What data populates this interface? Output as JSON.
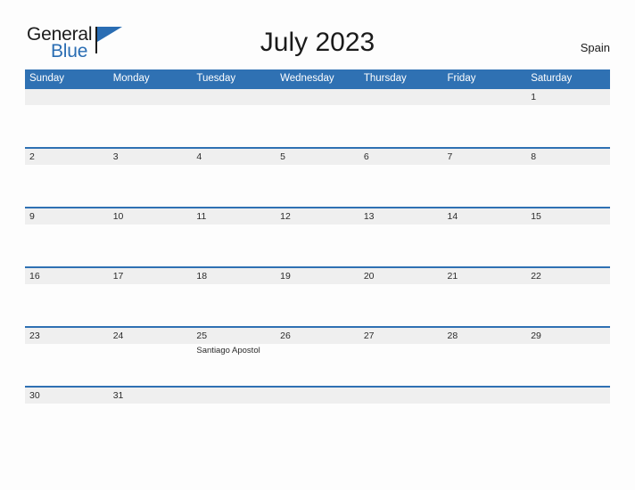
{
  "brand": {
    "name_part1": "General",
    "name_part2": "Blue",
    "flag_icon": "triangle-flag-icon",
    "color_dark": "#1b1b1b",
    "color_blue": "#2a6db3"
  },
  "header": {
    "title": "July 2023",
    "country": "Spain"
  },
  "theme": {
    "header_blue": "#2f71b3",
    "day_band_gray": "#efefef",
    "page_background": "#fdfdfd",
    "text_dark": "#1b1b1b"
  },
  "calendar": {
    "weekdays": [
      "Sunday",
      "Monday",
      "Tuesday",
      "Wednesday",
      "Thursday",
      "Friday",
      "Saturday"
    ],
    "weeks": [
      [
        {
          "day": "",
          "event": ""
        },
        {
          "day": "",
          "event": ""
        },
        {
          "day": "",
          "event": ""
        },
        {
          "day": "",
          "event": ""
        },
        {
          "day": "",
          "event": ""
        },
        {
          "day": "",
          "event": ""
        },
        {
          "day": "1",
          "event": ""
        }
      ],
      [
        {
          "day": "2",
          "event": ""
        },
        {
          "day": "3",
          "event": ""
        },
        {
          "day": "4",
          "event": ""
        },
        {
          "day": "5",
          "event": ""
        },
        {
          "day": "6",
          "event": ""
        },
        {
          "day": "7",
          "event": ""
        },
        {
          "day": "8",
          "event": ""
        }
      ],
      [
        {
          "day": "9",
          "event": ""
        },
        {
          "day": "10",
          "event": ""
        },
        {
          "day": "11",
          "event": ""
        },
        {
          "day": "12",
          "event": ""
        },
        {
          "day": "13",
          "event": ""
        },
        {
          "day": "14",
          "event": ""
        },
        {
          "day": "15",
          "event": ""
        }
      ],
      [
        {
          "day": "16",
          "event": ""
        },
        {
          "day": "17",
          "event": ""
        },
        {
          "day": "18",
          "event": ""
        },
        {
          "day": "19",
          "event": ""
        },
        {
          "day": "20",
          "event": ""
        },
        {
          "day": "21",
          "event": ""
        },
        {
          "day": "22",
          "event": ""
        }
      ],
      [
        {
          "day": "23",
          "event": ""
        },
        {
          "day": "24",
          "event": ""
        },
        {
          "day": "25",
          "event": "Santiago Apostol"
        },
        {
          "day": "26",
          "event": ""
        },
        {
          "day": "27",
          "event": ""
        },
        {
          "day": "28",
          "event": ""
        },
        {
          "day": "29",
          "event": ""
        }
      ],
      [
        {
          "day": "30",
          "event": ""
        },
        {
          "day": "31",
          "event": ""
        },
        {
          "day": "",
          "event": ""
        },
        {
          "day": "",
          "event": ""
        },
        {
          "day": "",
          "event": ""
        },
        {
          "day": "",
          "event": ""
        },
        {
          "day": "",
          "event": ""
        }
      ]
    ]
  }
}
